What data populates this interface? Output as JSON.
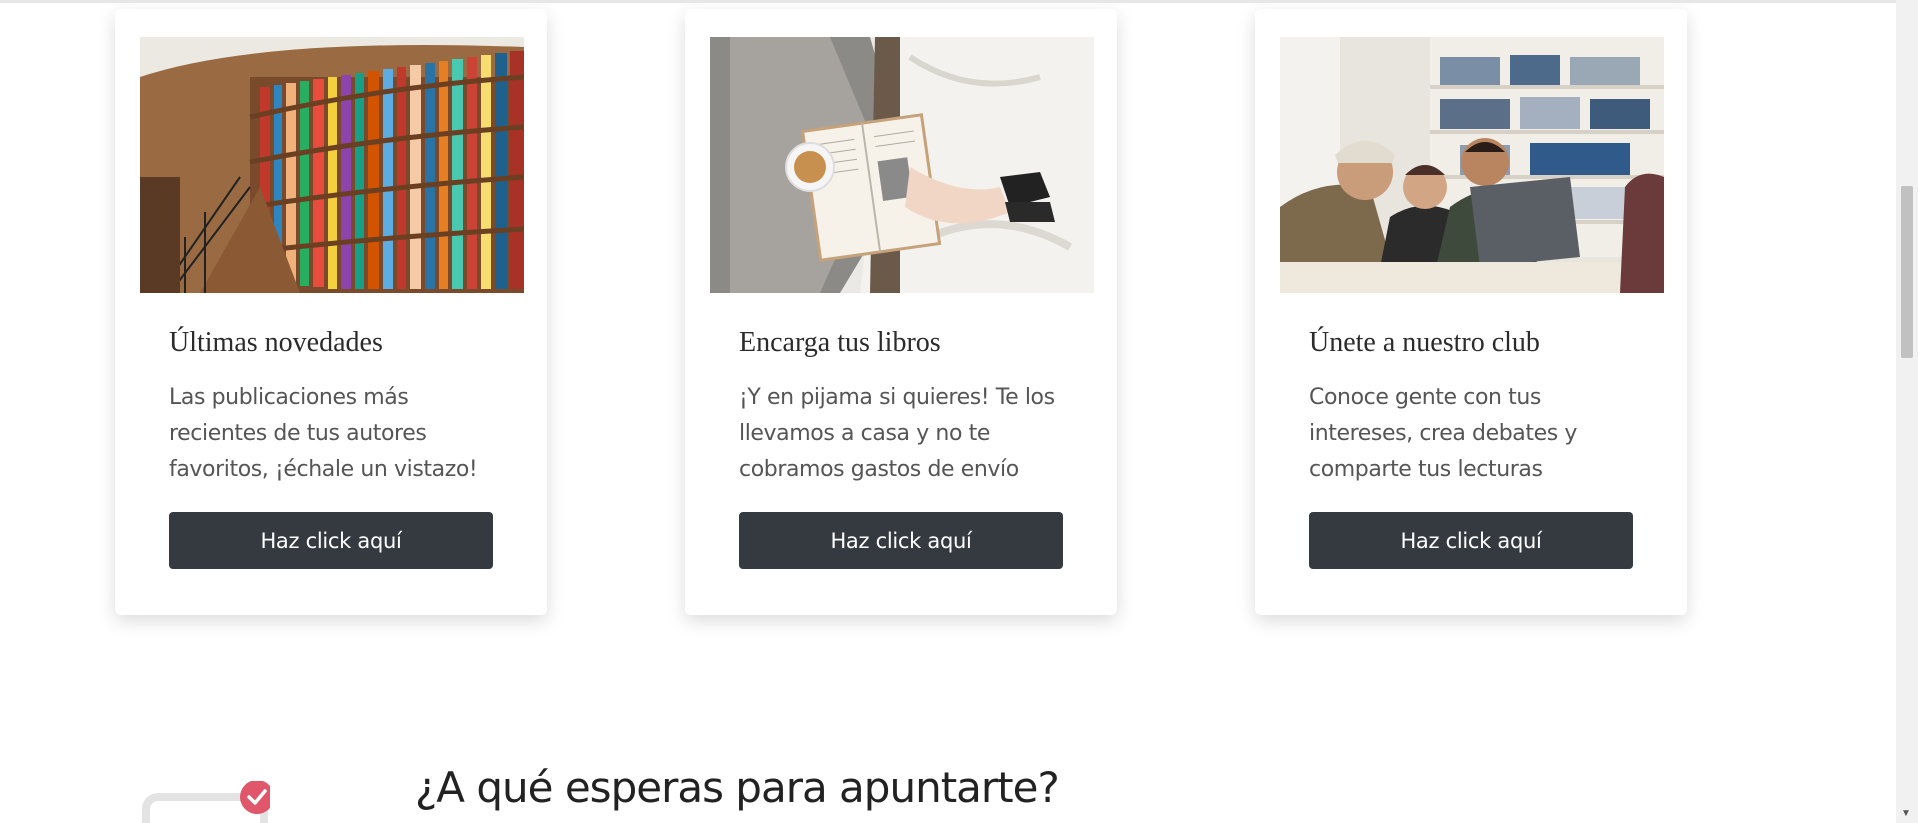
{
  "cards": [
    {
      "title": "Últimas novedades",
      "text": "Las publicaciones más recientes de tus autores favoritos, ¡échale un vistazo!",
      "button_label": "Haz click aquí",
      "image": "library-bookshelves-photo"
    },
    {
      "title": "Encarga tus libros",
      "text": "¡Y en pijama si quieres! Te los llevamos a casa y no te cobramos gastos de envío",
      "button_label": "Haz click aquí",
      "image": "reading-in-bed-photo"
    },
    {
      "title": "Únete a nuestro club",
      "text": "Conoce gente con tus intereses, crea debates y comparte tus lecturas",
      "button_label": "Haz click aquí",
      "image": "friends-laughing-laptop-photo"
    }
  ],
  "cta": {
    "title": "¿A qué esperas para apuntarte?",
    "icon": "checklist-icon"
  },
  "colors": {
    "button_bg": "#343a40",
    "check_badge": "#e0566a"
  }
}
